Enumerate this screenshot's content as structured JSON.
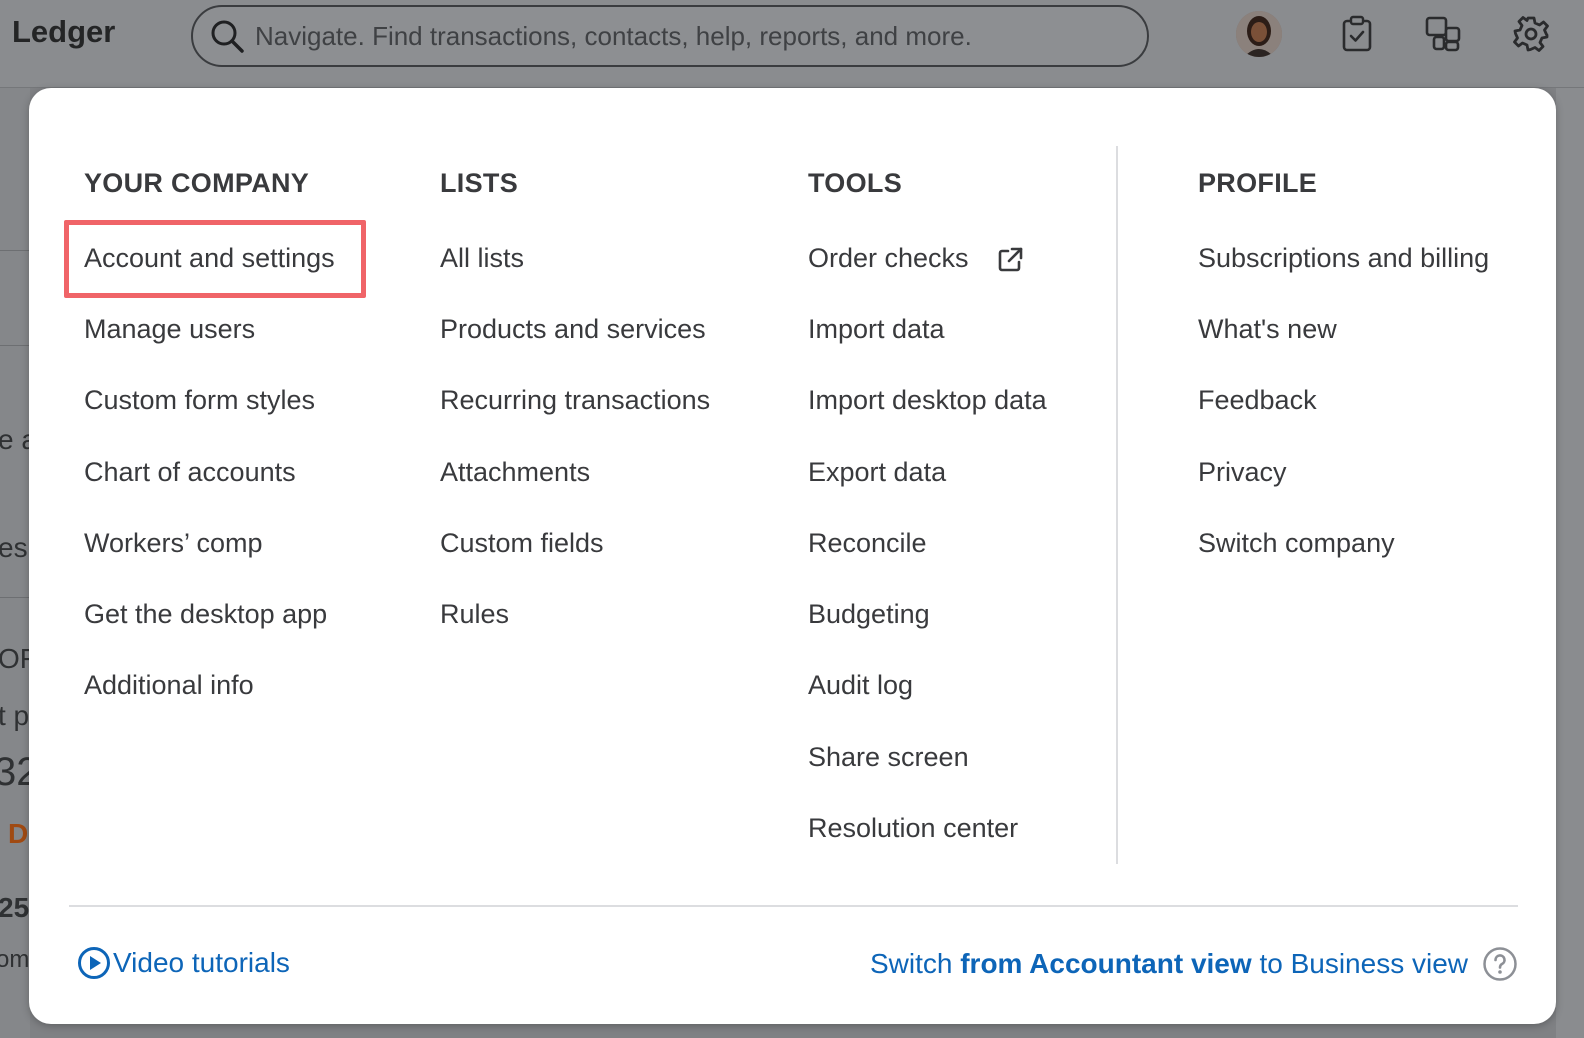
{
  "app": {
    "brand": "Ledger"
  },
  "search": {
    "placeholder": "Navigate. Find transactions, contacts, help, reports, and more."
  },
  "topbar_icons": [
    "avatar",
    "clipboard-check-icon",
    "apps-icon",
    "gear-icon"
  ],
  "background_fragments": [
    "e a",
    "es",
    "OF",
    "t p",
    "32",
    "D",
    "25",
    "om"
  ],
  "menu": {
    "columns": [
      {
        "heading": "YOUR COMPANY",
        "items": [
          "Account and settings",
          "Manage users",
          "Custom form styles",
          "Chart of accounts",
          "Workers’ comp",
          "Get the desktop app",
          "Additional info"
        ]
      },
      {
        "heading": "LISTS",
        "items": [
          "All lists",
          "Products and services",
          "Recurring transactions",
          "Attachments",
          "Custom fields",
          "Rules"
        ]
      },
      {
        "heading": "TOOLS",
        "items": [
          "Order checks",
          "Import data",
          "Import desktop data",
          "Export data",
          "Reconcile",
          "Budgeting",
          "Audit log",
          "Share screen",
          "Resolution center"
        ]
      },
      {
        "heading": "PROFILE",
        "items": [
          "Subscriptions and billing",
          "What's new",
          "Feedback",
          "Privacy",
          "Switch company"
        ]
      }
    ],
    "highlighted_item": "Account and settings"
  },
  "footer": {
    "video_tutorials": "Video tutorials",
    "switch_part1": "Switch ",
    "switch_part2": "from Accountant view",
    "switch_part3": " to Business view"
  },
  "colors": {
    "link": "#0d65b8",
    "highlight": "#f06468",
    "text": "#393a3d"
  }
}
